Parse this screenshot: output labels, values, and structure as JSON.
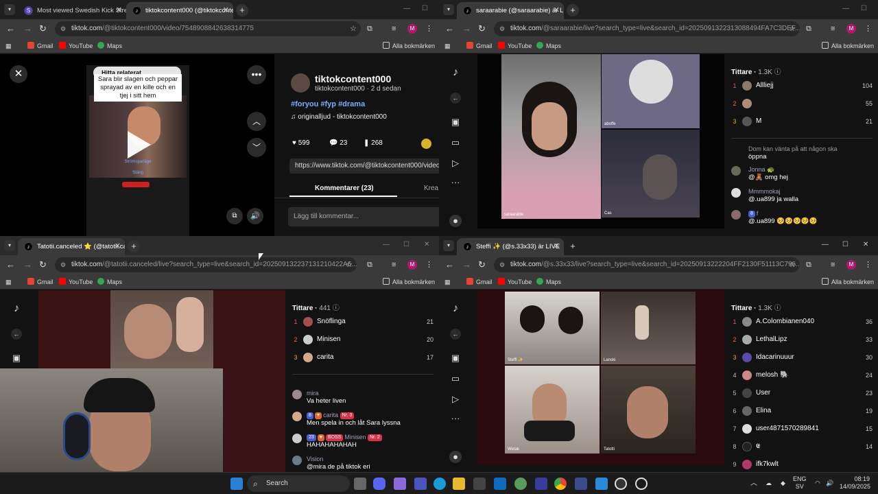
{
  "bookmarks": {
    "gmail": "Gmail",
    "youtube": "YouTube",
    "maps": "Maps",
    "all": "Alla bokmärken"
  },
  "w1": {
    "tabs": [
      {
        "title": "Most viewed Swedish Kick Strea"
      },
      {
        "title": "tiktokcontent000 (@tiktokconte"
      }
    ],
    "url_host": "tiktok.com",
    "url_path": "/@tiktokcontent000/video/7548908842638314775",
    "video_caption": "Sara blir slagen och peppar sprayad av en kille och en tjej i sitt hem",
    "video_top_text": "Hitta relaterat",
    "video_inner_label": "Strömspariäge",
    "video_inner_close": "Stäng",
    "author_name": "tiktokcontent000",
    "author_sub": "tiktokcontent000 · 2 d sedan",
    "hashtags": "#foryou #fyp #drama",
    "sound": "originalljud - tiktokcontent000",
    "likes": "599",
    "comments": "23",
    "saves": "268",
    "share_url": "https://www.tiktok.com/@tiktokcontent000/video",
    "tab_comments": "Kommentarer (23)",
    "tab_creator": "Krea",
    "comment_placeholder": "Lägg till kommentar..."
  },
  "w2": {
    "tab_title": "saraarabie (@saraarabie) är LIVE",
    "url_host": "tiktok.com",
    "url_path": "/@saraarabie/live?search_type=live&search_id=20250913223130884​94FA7C3DEF...",
    "viewers_label": "Tittare",
    "viewers_count": "1.3K",
    "top": [
      {
        "rank": "1",
        "name": "Allliejj",
        "score": "104"
      },
      {
        "rank": "2",
        "name": "",
        "score": "55"
      },
      {
        "rank": "3",
        "name": "M",
        "score": "21"
      }
    ],
    "chat": [
      {
        "user": "Dom kan vänta på att någon ska",
        "msg": "öppna"
      },
      {
        "user": "Jonna 🐢",
        "msg": "@🧸 omg hej"
      },
      {
        "user": "Mmmmokaj",
        "msg": "@.ua899 ja walla"
      },
      {
        "user": "f",
        "msg": "@.ua899 🥺🥺🥺🥺🥺"
      }
    ],
    "tile_labels": [
      "saraarabie",
      "Cas",
      "aboffe"
    ]
  },
  "w3": {
    "tab_title": "Tatotii.canceled ⭐ (@tatotii.ca",
    "url_host": "tiktok.com",
    "url_path": "/@tatotii.canceled/live?search_type=live&search_id=20250913223713121​0422A6...",
    "viewers_label": "Tittare",
    "viewers_count": "441",
    "top": [
      {
        "rank": "1",
        "name": "Snöflinga",
        "score": "21"
      },
      {
        "rank": "2",
        "name": "Minisen",
        "score": "20"
      },
      {
        "rank": "3",
        "name": "carita",
        "score": "17"
      }
    ],
    "chat": [
      {
        "user": "mira",
        "msg": "Va heter liven"
      },
      {
        "user": "carita",
        "badge1": "8",
        "badge2": "Nr. 3",
        "msg": "Men spela in och låt Sara lyssna"
      },
      {
        "user": "Minisen",
        "badge1": "23",
        "badge2": "BOSS",
        "badge3": "Nr. 2",
        "msg": "HAHAHAHAHAH"
      },
      {
        "user": "Vision",
        "msg": "@mira de på tiktok eri"
      }
    ]
  },
  "w4": {
    "tab_title": "Steffi ✨ (@s.33x33) är LIVE",
    "url_host": "tiktok.com",
    "url_path": "/@s.33x33/live?search_type=live&search_id=20250913222204FF2130F51113C796...",
    "viewers_label": "Tittare",
    "viewers_count": "1.3K",
    "top": [
      {
        "rank": "1",
        "name": "A.Colombianen040",
        "score": "36"
      },
      {
        "rank": "2",
        "name": "LethalLipz",
        "score": "33"
      },
      {
        "rank": "3",
        "name": "Idacarinuuur",
        "score": "30"
      },
      {
        "rank": "4",
        "name": "melosh 🐘",
        "score": "24"
      },
      {
        "rank": "5",
        "name": "User",
        "score": "23"
      },
      {
        "rank": "6",
        "name": "Elina",
        "score": "19"
      },
      {
        "rank": "7",
        "name": "user4871570289841",
        "score": "15"
      },
      {
        "rank": "8",
        "name": "𝕰",
        "score": "14"
      },
      {
        "rank": "9",
        "name": "ifk7kwlt",
        "score": ""
      }
    ],
    "tile_labels": [
      "Steffi ✨",
      "Lanski",
      "Wetak",
      "Tatotti"
    ]
  },
  "taskbar": {
    "search": "Search",
    "lang1": "ENG",
    "lang2": "SV",
    "time": "08:19",
    "date": "14/09/2025"
  }
}
